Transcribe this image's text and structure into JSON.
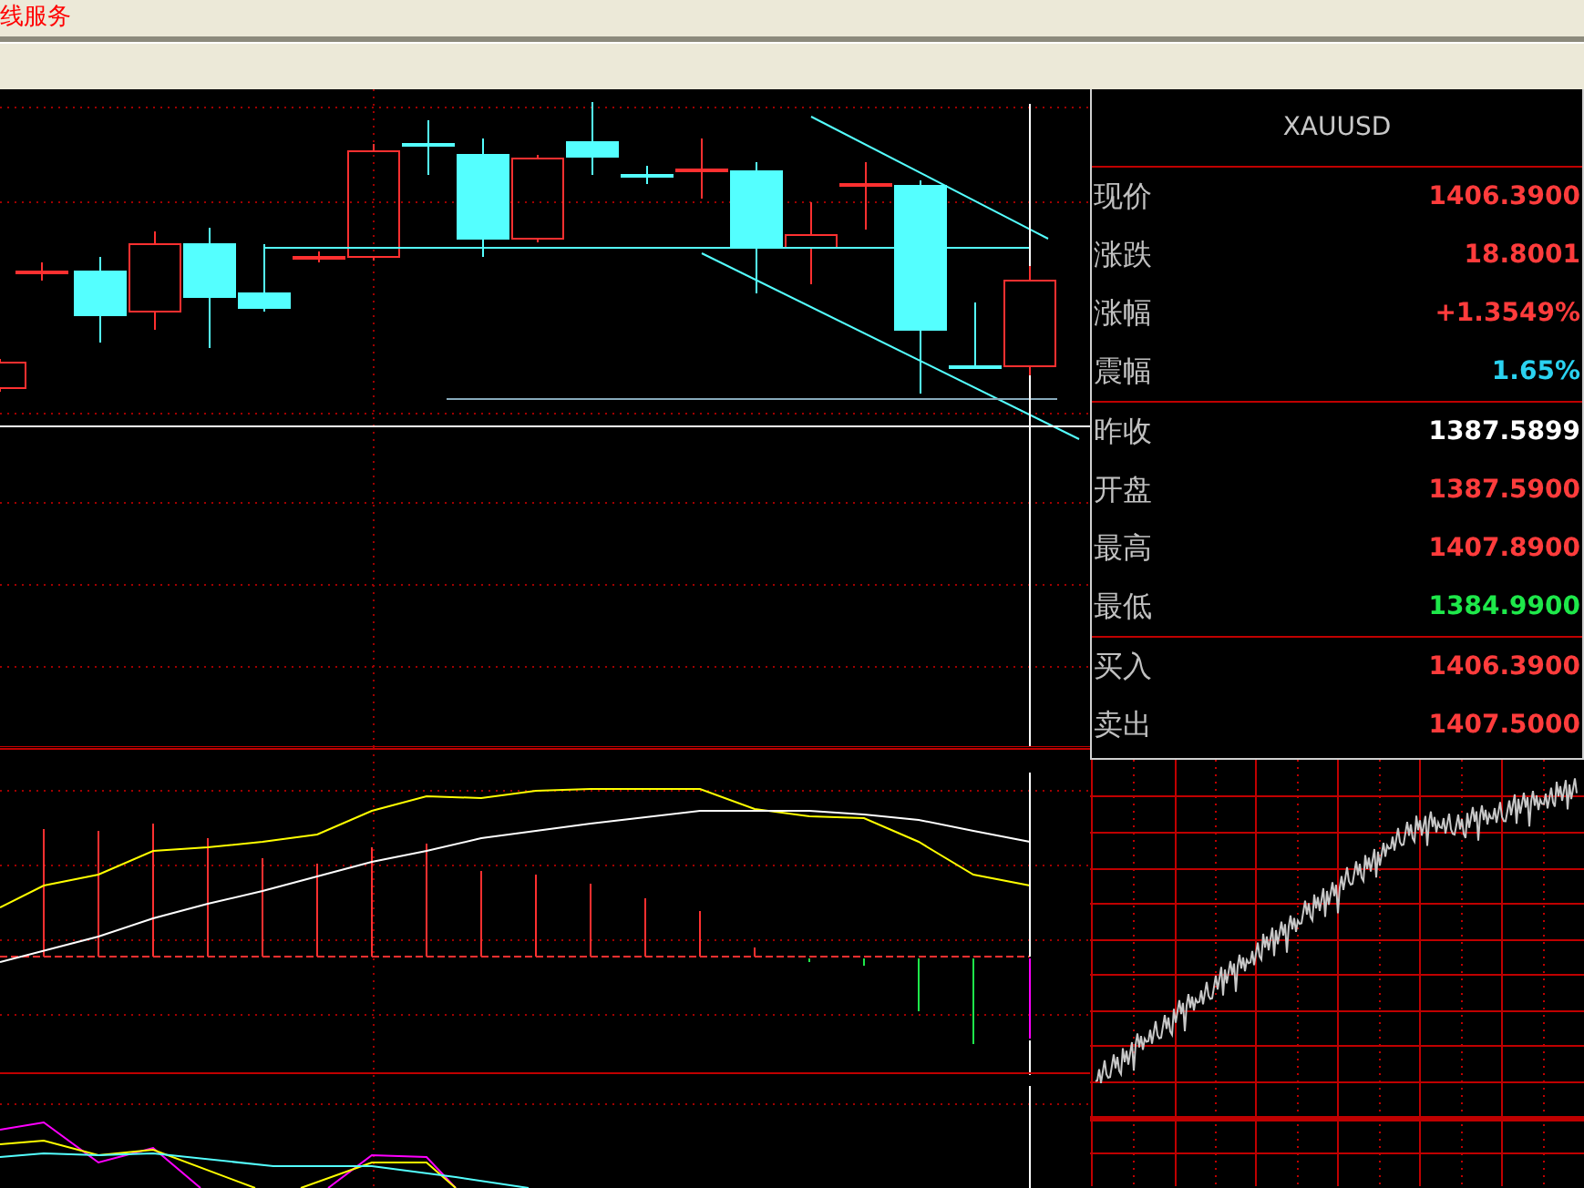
{
  "window": {
    "title": "线服务"
  },
  "quote_panel": {
    "symbol": "XAUUSD",
    "sections": [
      [
        {
          "label": "现价",
          "value": "1406.3900",
          "color": "#ff3c3c"
        },
        {
          "label": "涨跌",
          "value": "18.8001",
          "color": "#ff3c3c"
        },
        {
          "label": "涨幅",
          "value": "+1.3549%",
          "color": "#ff3c3c"
        },
        {
          "label": "震幅",
          "value": "1.65%",
          "color": "#2ad2f0"
        }
      ],
      [
        {
          "label": "昨收",
          "value": "1387.5899",
          "color": "#ffffff"
        },
        {
          "label": "开盘",
          "value": "1387.5900",
          "color": "#ff3c3c"
        },
        {
          "label": "最高",
          "value": "1407.8900",
          "color": "#ff3c3c"
        },
        {
          "label": "最低",
          "value": "1384.9900",
          "color": "#1ee84a"
        }
      ],
      [
        {
          "label": "买入",
          "value": "1406.3900",
          "color": "#ff3c3c"
        },
        {
          "label": "卖出",
          "value": "1407.5000",
          "color": "#ff3c3c"
        }
      ]
    ]
  }
}
